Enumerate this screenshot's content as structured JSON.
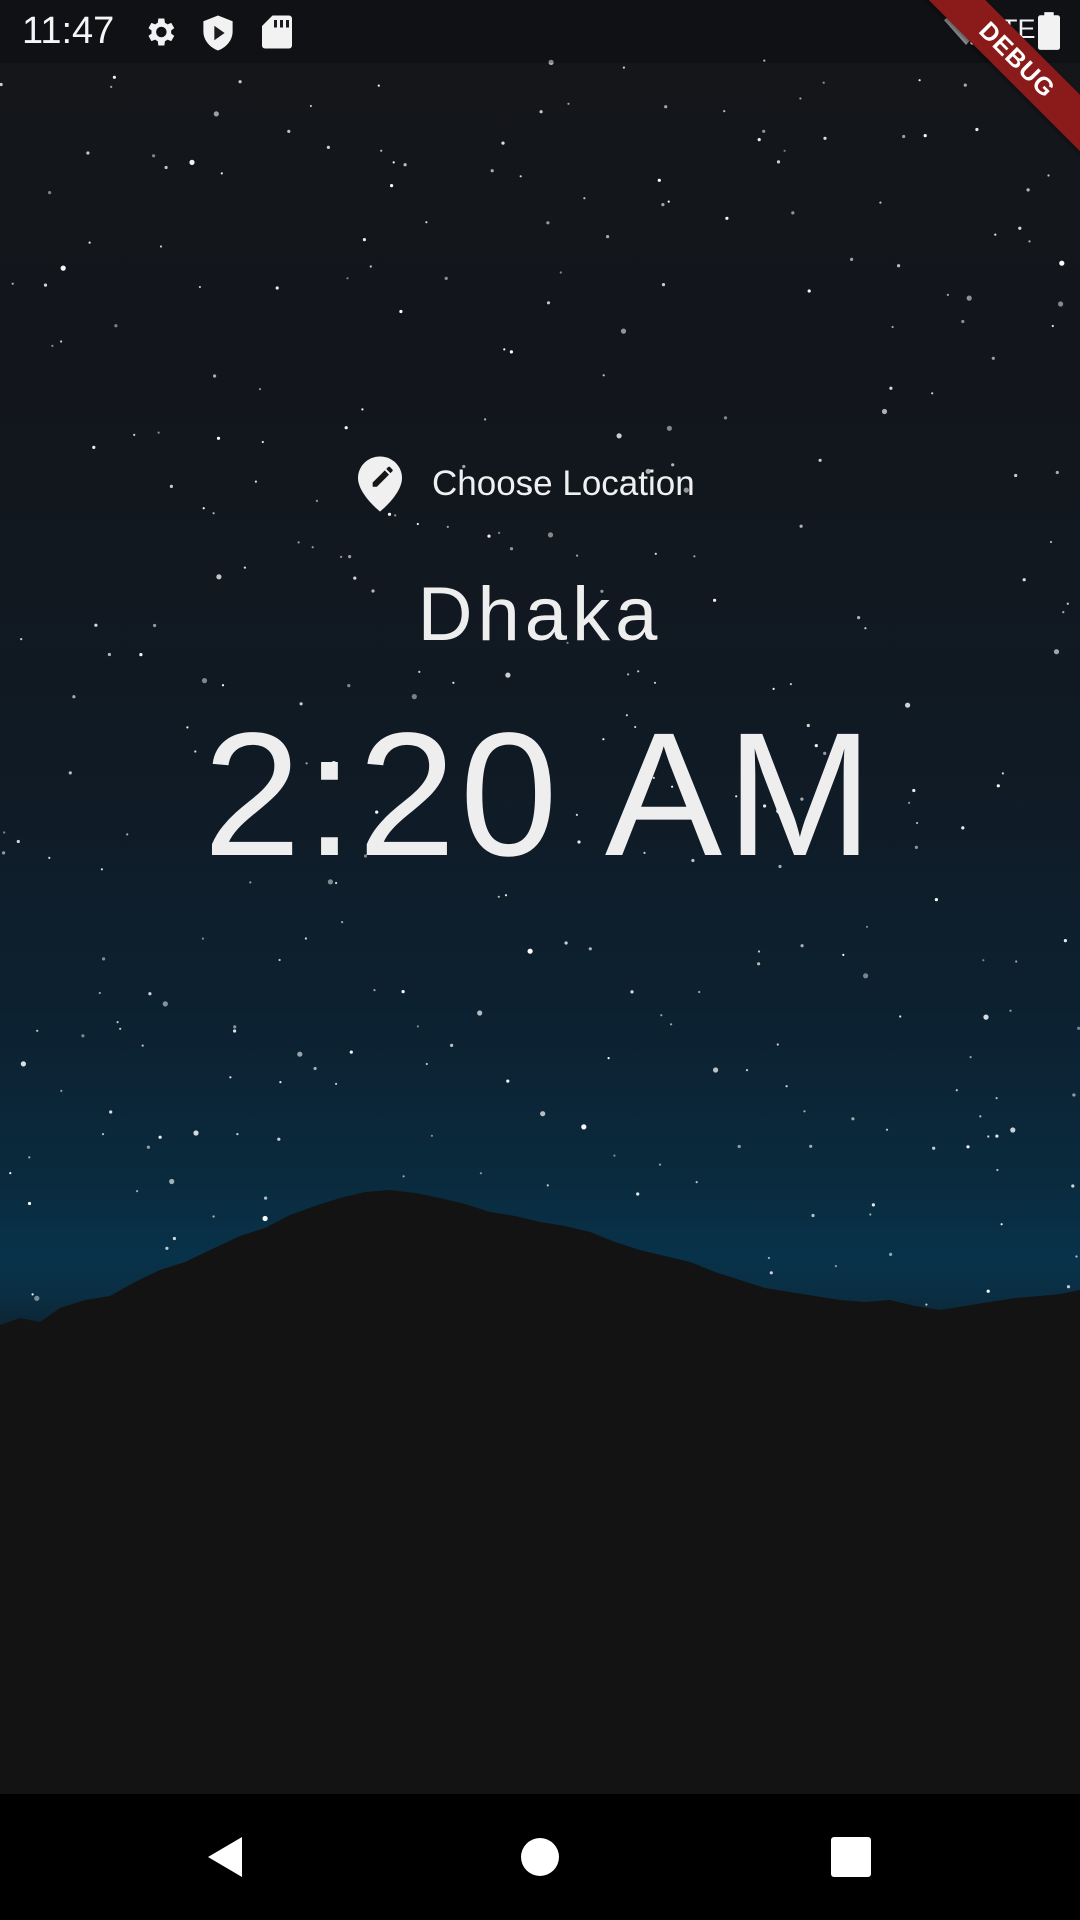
{
  "status_bar": {
    "time": "11:47",
    "icons": [
      "settings-icon",
      "play-protect-icon",
      "sd-card-icon",
      "wifi-off-icon",
      "lte-signal-icon",
      "battery-icon"
    ],
    "network_label": "LTE"
  },
  "debug_banner": {
    "label": "DEBUG",
    "color": "#8b1a1a"
  },
  "main": {
    "choose_location": {
      "icon": "location-edit-icon",
      "label": "Choose Location"
    },
    "city": "Dhaka",
    "time": "2:20 AM"
  },
  "nav_bar": {
    "buttons": [
      "back-icon",
      "home-icon",
      "recents-icon"
    ]
  },
  "colors": {
    "text": "#eeeeee",
    "sky_top": "#14161a",
    "sky_horizon": "#08324a",
    "ground": "#131313",
    "nav_bar": "#000000"
  }
}
